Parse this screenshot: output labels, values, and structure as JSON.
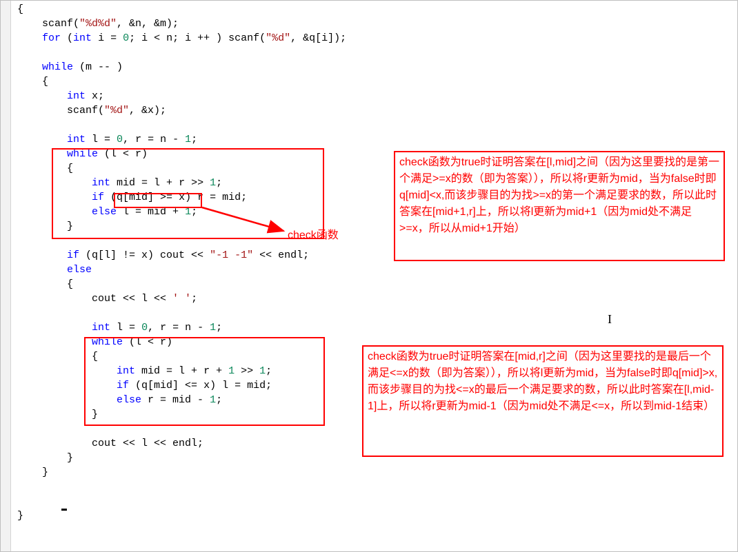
{
  "code_lines": [
    "{",
    "    scanf(\"%d%d\", &n, &m);",
    "    for (int i = 0; i < n; i ++ ) scanf(\"%d\", &q[i]);",
    "",
    "    while (m -- )",
    "    {",
    "        int x;",
    "        scanf(\"%d\", &x);",
    "",
    "        int l = 0, r = n - 1;",
    "        while (l < r)",
    "        {",
    "            int mid = l + r >> 1;",
    "            if (q[mid] >= x) r = mid;",
    "            else l = mid + 1;",
    "        }",
    "",
    "        if (q[l] != x) cout << \"-1 -1\" << endl;",
    "        else",
    "        {",
    "            cout << l << ' ';",
    "",
    "            int l = 0, r = n - 1;",
    "            while (l < r)",
    "            {",
    "                int mid = l + r + 1 >> 1;",
    "                if (q[mid] <= x) l = mid;",
    "                else r = mid - 1;",
    "            }",
    "",
    "            cout << l << endl;",
    "        }",
    "    }",
    "",
    "",
    "}"
  ],
  "keywords": [
    "int",
    "for",
    "if",
    "else",
    "while"
  ],
  "annotations": {
    "label_check": "check函数",
    "box1_text": "check函数为true时证明答案在[l,mid]之间（因为这里要找的是第一个满足>=x的数（即为答案）），所以将r更新为mid，当为false时即q[mid]<x,而该步骤目的为找>=x的第一个满足要求的数，所以此时答案在[mid+1,r]上，所以将l更新为mid+1（因为mid处不满足>=x，所以从mid+1开始）",
    "box2_text": "check函数为true时证明答案在[mid,r]之间（因为这里要找的是最后一个满足<=x的数（即为答案）），所以将l更新为mid，当为false时即q[mid]>x,而该步骤目的为找<=x的最后一个满足要求的数，所以此时答案在[l,mid-1]上，所以将r更新为mid-1（因为mid处不满足<=x，所以到mid-1结束）"
  },
  "colors": {
    "anno_red": "#ff0000"
  }
}
